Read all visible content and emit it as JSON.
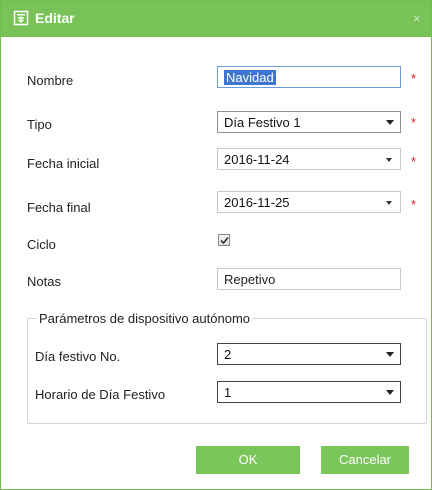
{
  "dialog": {
    "title": "Editar",
    "close_glyph": "×",
    "accent_color": "#78c257",
    "required_color": "#e02020"
  },
  "form": {
    "nombre": {
      "label": "Nombre",
      "value": "Navidad",
      "required": "*"
    },
    "tipo": {
      "label": "Tipo",
      "value": "Día Festivo 1",
      "required": "*"
    },
    "fecha_inicial": {
      "label": "Fecha inicial",
      "value": "2016-11-24",
      "required": "*"
    },
    "fecha_final": {
      "label": "Fecha final",
      "value": "2016-11-25",
      "required": "*"
    },
    "ciclo": {
      "label": "Ciclo",
      "checked": true
    },
    "notas": {
      "label": "Notas",
      "value": "Repetivo"
    }
  },
  "device_params": {
    "legend": "Parámetros de dispositivo autónomo",
    "dia_festivo_no": {
      "label": "Día festivo No.",
      "value": "2"
    },
    "horario": {
      "label": "Horario de Día Festivo",
      "value": "1"
    }
  },
  "buttons": {
    "ok": "OK",
    "cancel": "Cancelar"
  },
  "icons": {
    "title": "edit-document-icon",
    "close": "close-icon",
    "dropdown": "chevron-down-icon",
    "check": "checkmark-icon"
  }
}
